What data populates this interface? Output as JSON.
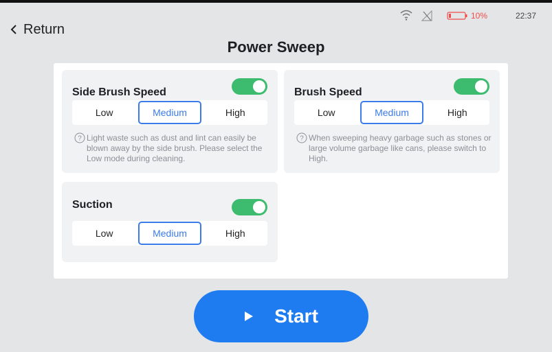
{
  "status": {
    "battery": "10%",
    "time": "22:37",
    "icons": [
      "wifi-icon",
      "no-signal-icon",
      "battery-icon"
    ],
    "battery_color": "#f04b4b"
  },
  "header": {
    "return_label": "Return",
    "title": "Power Sweep"
  },
  "cards": [
    {
      "title": "Side Brush Speed",
      "enabled": true,
      "options": [
        "Low",
        "Medium",
        "High"
      ],
      "selected": "Medium",
      "hint": "Light waste such as dust and lint can easily be blown away by the side brush. Please select the Low mode during cleaning."
    },
    {
      "title": "Brush Speed",
      "enabled": true,
      "options": [
        "Low",
        "Medium",
        "High"
      ],
      "selected": "Medium",
      "hint": "When sweeping heavy garbage such as stones or large volume garbage like cans, please switch to High."
    },
    {
      "title": "Suction",
      "enabled": true,
      "options": [
        "Low",
        "Medium",
        "High"
      ],
      "selected": "Medium"
    }
  ],
  "action": {
    "start_label": "Start"
  },
  "colors": {
    "accent": "#1e7cf0",
    "selected_border": "#3a7be8",
    "toggle_on": "#3dbb6e"
  }
}
